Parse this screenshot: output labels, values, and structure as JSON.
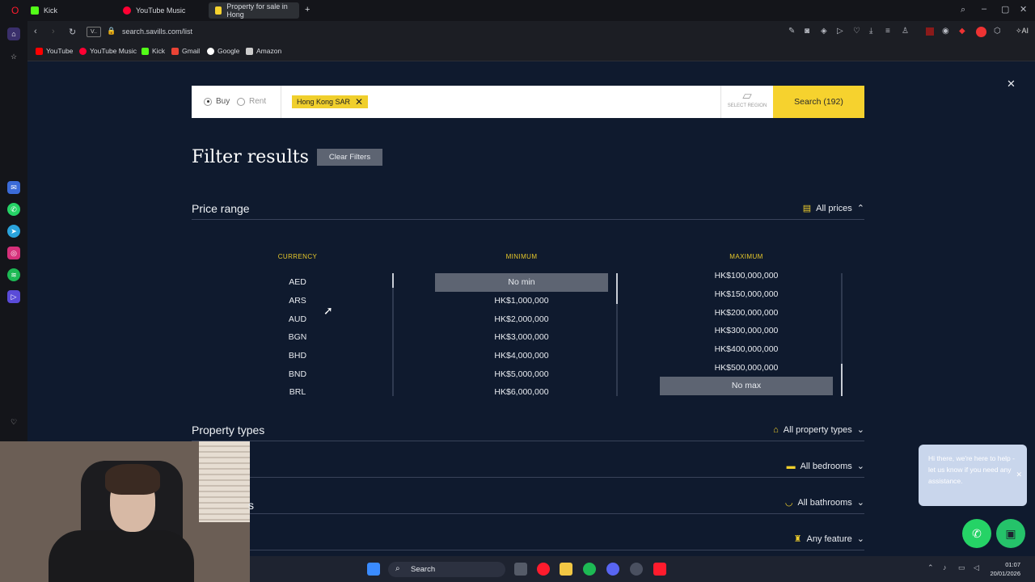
{
  "browser": {
    "tabs": [
      {
        "label": "Kick",
        "color": "#53fc18",
        "active": false
      },
      {
        "label": "YouTube Music",
        "color": "#ff0033",
        "active": false
      },
      {
        "label": "Property for sale in Hong",
        "color": "#f6d22e",
        "active": true
      }
    ],
    "address": "search.savills.com/list",
    "address_prefix": "V..",
    "bookmarks": [
      {
        "label": "YouTube",
        "color": "#ff0000"
      },
      {
        "label": "YouTube Music",
        "color": "#ff0033"
      },
      {
        "label": "Kick",
        "color": "#53fc18"
      },
      {
        "label": "Gmail",
        "color": "#ea4335"
      },
      {
        "label": "Google",
        "color": "#ffffff"
      },
      {
        "label": "Amazon",
        "color": "#cccccc"
      }
    ]
  },
  "search": {
    "buy_label": "Buy",
    "rent_label": "Rent",
    "chip_label": "Hong Kong SAR",
    "select_region": "SELECT REGION",
    "search_button": "Search (192)"
  },
  "filters": {
    "title": "Filter results",
    "clear_button": "Clear Filters",
    "price_range": {
      "label": "Price range",
      "summary": "All prices",
      "currency_head": "CURRENCY",
      "minimum_head": "MINIMUM",
      "maximum_head": "MAXIMUM",
      "currencies": [
        "AED",
        "ARS",
        "AUD",
        "BGN",
        "BHD",
        "BND",
        "BRL"
      ],
      "minimums": [
        "No min",
        "HK$1,000,000",
        "HK$2,000,000",
        "HK$3,000,000",
        "HK$4,000,000",
        "HK$5,000,000",
        "HK$6,000,000"
      ],
      "maximums": [
        "HK$100,000,000",
        "HK$150,000,000",
        "HK$200,000,000",
        "HK$300,000,000",
        "HK$400,000,000",
        "HK$500,000,000",
        "No max"
      ]
    },
    "property_types": {
      "label": "Property types",
      "summary": "All property types"
    },
    "bedrooms_summary": "All bedrooms",
    "bathrooms_summary": "All bathrooms",
    "bathrooms_partial": "s",
    "features_summary": "Any feature"
  },
  "chat": {
    "message": "Hi there, we're here to help - let us know if you need any assistance."
  },
  "taskbar": {
    "search_label": "Search",
    "time": "01:07",
    "date": "20/01/2026"
  }
}
